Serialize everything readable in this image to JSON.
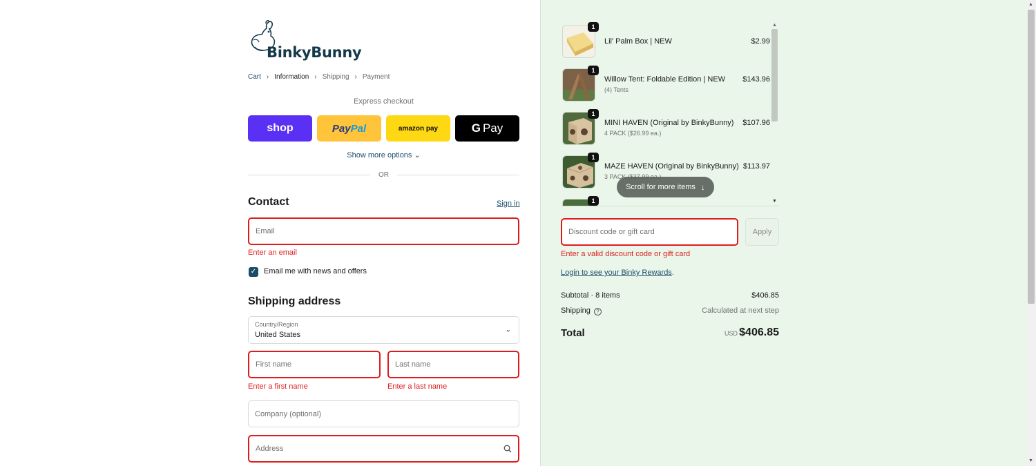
{
  "brand": {
    "name": "BinkyBunny"
  },
  "breadcrumb": [
    {
      "label": "Cart"
    },
    {
      "label": "Information"
    },
    {
      "label": "Shipping"
    },
    {
      "label": "Payment"
    }
  ],
  "express": {
    "title": "Express checkout",
    "shop_label": "shop",
    "paypal_label_1": "Pay",
    "paypal_label_2": "Pal",
    "amazon_label": "amazon pay",
    "gpay_g": "G",
    "gpay_label": "Pay",
    "show_more": "Show more options",
    "or": "OR"
  },
  "contact": {
    "title": "Contact",
    "sign_in": "Sign in",
    "email_placeholder": "Email",
    "email_error": "Enter an email",
    "newsletter_label": "Email me with news and offers",
    "newsletter_checked": true
  },
  "shipping": {
    "title": "Shipping address",
    "country_label": "Country/Region",
    "country_value": "United States",
    "first_name_placeholder": "First name",
    "first_name_error": "Enter a first name",
    "last_name_placeholder": "Last name",
    "last_name_error": "Enter a last name",
    "company_placeholder": "Company (optional)",
    "address_placeholder": "Address"
  },
  "cart": {
    "items": [
      {
        "name": "Lil' Palm Box | NEW",
        "sub": "",
        "price": "$2.99",
        "qty": "1"
      },
      {
        "name": "Willow Tent: Foldable Edition | NEW",
        "sub": "(4) Tents",
        "price": "$143.96",
        "qty": "1"
      },
      {
        "name": "MINI HAVEN (Original by BinkyBunny)",
        "sub": "4 PACK ($26.99 ea.)",
        "price": "$107.96",
        "qty": "1"
      },
      {
        "name": "MAZE HAVEN (Original by BinkyBunny)",
        "sub": "3 PACK ($37.99 ea.)",
        "price": "$113.97",
        "qty": "1"
      },
      {
        "name": "",
        "sub": "",
        "price": "",
        "qty": "1"
      }
    ],
    "scroll_hint": "Scroll for more items",
    "discount_placeholder": "Discount code or gift card",
    "discount_error": "Enter a valid discount code or gift card",
    "apply_label": "Apply",
    "rewards_link": "Login to see your Binky Rewards",
    "rewards_suffix": ".",
    "subtotal_label": "Subtotal · 8 items",
    "subtotal_value": "$406.85",
    "shipping_label": "Shipping",
    "shipping_value": "Calculated at next step",
    "total_label": "Total",
    "total_currency": "USD",
    "total_value": "$406.85"
  },
  "colors": {
    "accent": "#1b4d6b",
    "error": "#dd1d1d",
    "summary_bg": "#eaf6ea",
    "shop_pay": "#5a31f4",
    "paypal": "#ffc439",
    "amazon_pay": "#ffd814",
    "google_pay": "#000000"
  },
  "icons": {
    "breadcrumb_separator": "chevron-right-icon",
    "show_more": "chevron-down-icon",
    "country_select": "chevron-down-icon",
    "address_search": "search-icon",
    "scroll_hint": "arrow-down-icon",
    "shipping_help": "question-circle-icon"
  }
}
